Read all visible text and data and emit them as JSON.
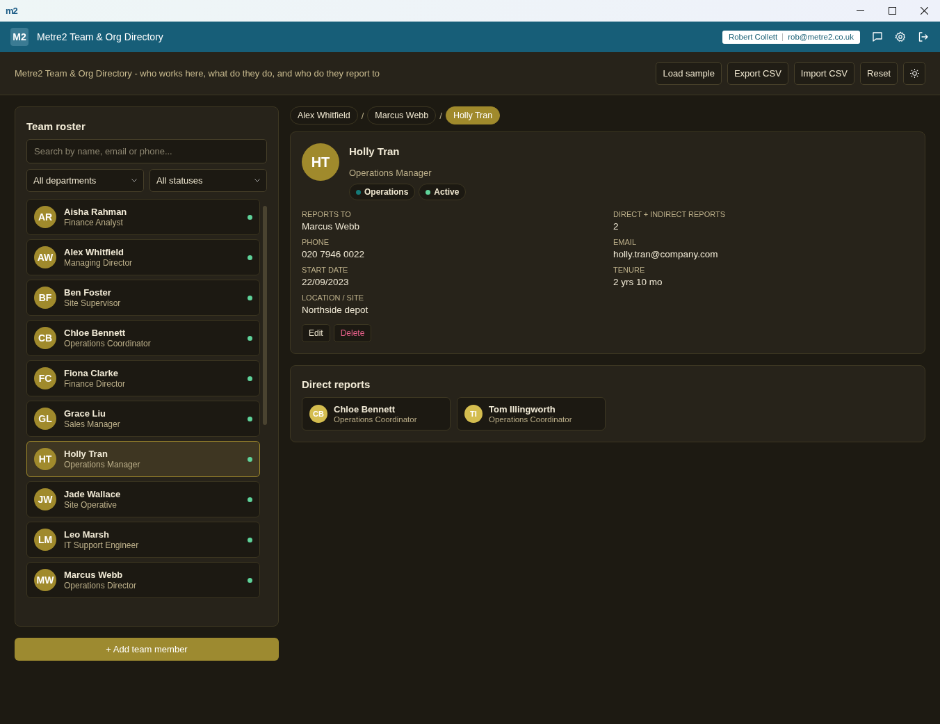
{
  "window": {
    "logo": "m2"
  },
  "header": {
    "badge": "M2",
    "title": "Metre2 Team & Org Directory",
    "user_name": "Robert Collett",
    "user_email": "rob@metre2.co.uk"
  },
  "toolbar": {
    "subtitle": "Metre2 Team & Org Directory - who works here, what do they do, and who do they report to",
    "buttons": [
      "Load sample",
      "Export CSV",
      "Import CSV",
      "Reset"
    ]
  },
  "roster": {
    "title": "Team roster",
    "search": {
      "placeholder": "Search by name, email or phone..."
    },
    "filters": [
      "All departments",
      "All statuses"
    ],
    "members": [
      {
        "initials": "AR",
        "name": "Aisha Rahman",
        "role": "Finance Analyst",
        "active": true,
        "selected": false
      },
      {
        "initials": "AW",
        "name": "Alex Whitfield",
        "role": "Managing Director",
        "active": true,
        "selected": false
      },
      {
        "initials": "BF",
        "name": "Ben Foster",
        "role": "Site Supervisor",
        "active": true,
        "selected": false
      },
      {
        "initials": "CB",
        "name": "Chloe Bennett",
        "role": "Operations Coordinator",
        "active": true,
        "selected": false
      },
      {
        "initials": "FC",
        "name": "Fiona Clarke",
        "role": "Finance Director",
        "active": true,
        "selected": false
      },
      {
        "initials": "GL",
        "name": "Grace Liu",
        "role": "Sales Manager",
        "active": true,
        "selected": false
      },
      {
        "initials": "HT",
        "name": "Holly Tran",
        "role": "Operations Manager",
        "active": true,
        "selected": true
      },
      {
        "initials": "JW",
        "name": "Jade Wallace",
        "role": "Site Operative",
        "active": true,
        "selected": false
      },
      {
        "initials": "LM",
        "name": "Leo Marsh",
        "role": "IT Support Engineer",
        "active": true,
        "selected": false
      },
      {
        "initials": "MW",
        "name": "Marcus Webb",
        "role": "Operations Director",
        "active": true,
        "selected": false
      }
    ]
  },
  "add_button": "+ Add team member",
  "breadcrumb": [
    {
      "label": "Alex Whitfield",
      "selected": false
    },
    {
      "separator": "/",
      "label": "Marcus Webb",
      "selected": false
    },
    {
      "separator": "/",
      "label": "Holly Tran",
      "selected": true
    }
  ],
  "profile": {
    "initials": "HT",
    "name": "Holly Tran",
    "role": "Operations Manager",
    "tags": [
      {
        "label": "Operations",
        "color": "#157a78"
      },
      {
        "label": "Active",
        "color": "#5fd39a"
      }
    ],
    "fields": [
      {
        "label": "REPORTS TO",
        "value": "Marcus Webb"
      },
      {
        "label": "DIRECT + INDIRECT REPORTS",
        "value": "2"
      },
      {
        "label": "PHONE",
        "value": "020 7946 0022"
      },
      {
        "label": "EMAIL",
        "value": "holly.tran@company.com"
      },
      {
        "label": "START DATE",
        "value": "22/09/2023"
      },
      {
        "label": "TENURE",
        "value": "2 yrs 10 mo"
      },
      {
        "label": "LOCATION / SITE",
        "value": "Northside depot"
      }
    ],
    "actions": [
      {
        "label": "Edit",
        "kind": "default"
      },
      {
        "label": "Delete",
        "kind": "danger"
      }
    ]
  },
  "direct_reports": {
    "title": "Direct reports",
    "items": [
      {
        "initials": "CB",
        "name": "Chloe Bennett",
        "role": "Operations Coordinator"
      },
      {
        "initials": "TI",
        "name": "Tom Illingworth",
        "role": "Operations Coordinator"
      }
    ]
  }
}
